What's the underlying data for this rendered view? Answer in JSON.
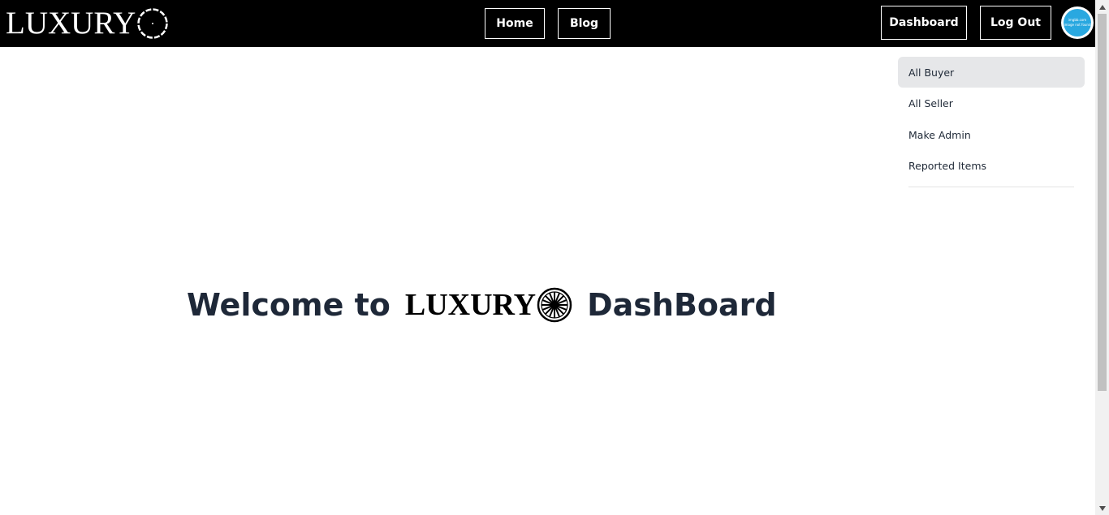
{
  "navbar": {
    "brand": "LUXURY",
    "home_label": "Home",
    "blog_label": "Blog",
    "dashboard_label": "Dashboard",
    "logout_label": "Log Out",
    "avatar_line1": "imgbb.com",
    "avatar_line2": "image not found"
  },
  "sidebar": {
    "items": [
      {
        "label": "All Buyer",
        "active": true
      },
      {
        "label": "All Seller",
        "active": false
      },
      {
        "label": "Make Admin",
        "active": false
      },
      {
        "label": "Reported Items",
        "active": false
      }
    ]
  },
  "main": {
    "welcome_prefix": "Welcome to",
    "logo_text": "LUXURY",
    "welcome_suffix": "DashBoard"
  },
  "colors": {
    "navbar_bg": "#000000",
    "heading": "#1e2838",
    "active_item_bg": "#e6e7e9",
    "avatar": "#29a8e0"
  },
  "icons": {
    "brand_logo": "wheel-icon",
    "scroll_up": "triangle-up-icon",
    "scroll_down": "triangle-down-icon"
  }
}
